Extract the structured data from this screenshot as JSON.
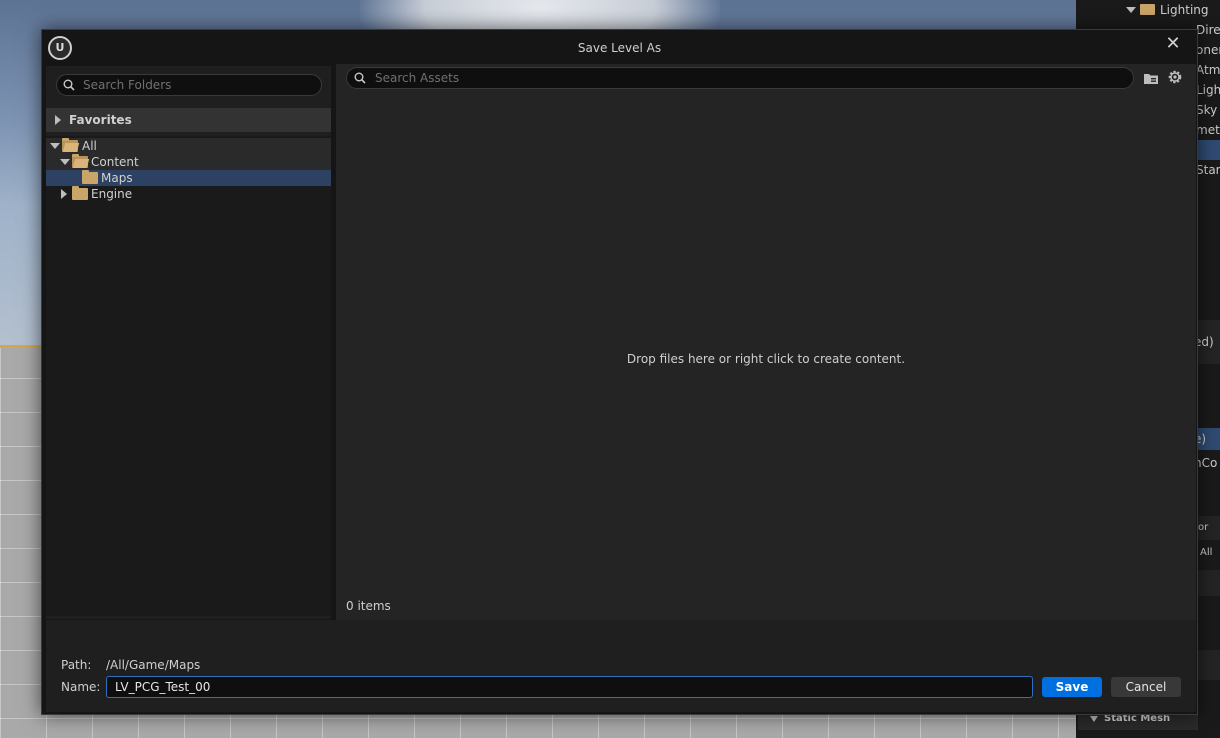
{
  "dialog": {
    "title": "Save Level As",
    "close_glyph": "✕"
  },
  "left_panel": {
    "search_placeholder": "Search Folders",
    "favorites_label": "Favorites",
    "tree": [
      {
        "label": "All",
        "state": "expanded"
      },
      {
        "label": "Content",
        "state": "expanded"
      },
      {
        "label": "Maps",
        "state": "selected"
      },
      {
        "label": "Engine",
        "state": "collapsed"
      }
    ]
  },
  "right_panel": {
    "search_placeholder": "Search Assets",
    "drop_hint": "Drop files here or right click to create content.",
    "item_count": "0 items"
  },
  "bottom": {
    "path_label": "Path:",
    "path_value": "/All/Game/Maps",
    "name_label": "Name:",
    "name_value": "LV_PCG_Test_00",
    "save_label": "Save",
    "cancel_label": "Cancel"
  },
  "outliner": {
    "rows": [
      "Lighting",
      "Directio",
      "oner",
      "Atm",
      "Ligh",
      "Sky",
      "met",
      "",
      "Star"
    ],
    "rows_lower": [
      "ed)",
      "e)",
      "hCo",
      "or",
      "All"
    ],
    "static_mesh_label": "Static Mesh"
  },
  "colors": {
    "accent": "#0070e0",
    "selection": "#2d4263",
    "folder": "#c9a56a"
  }
}
